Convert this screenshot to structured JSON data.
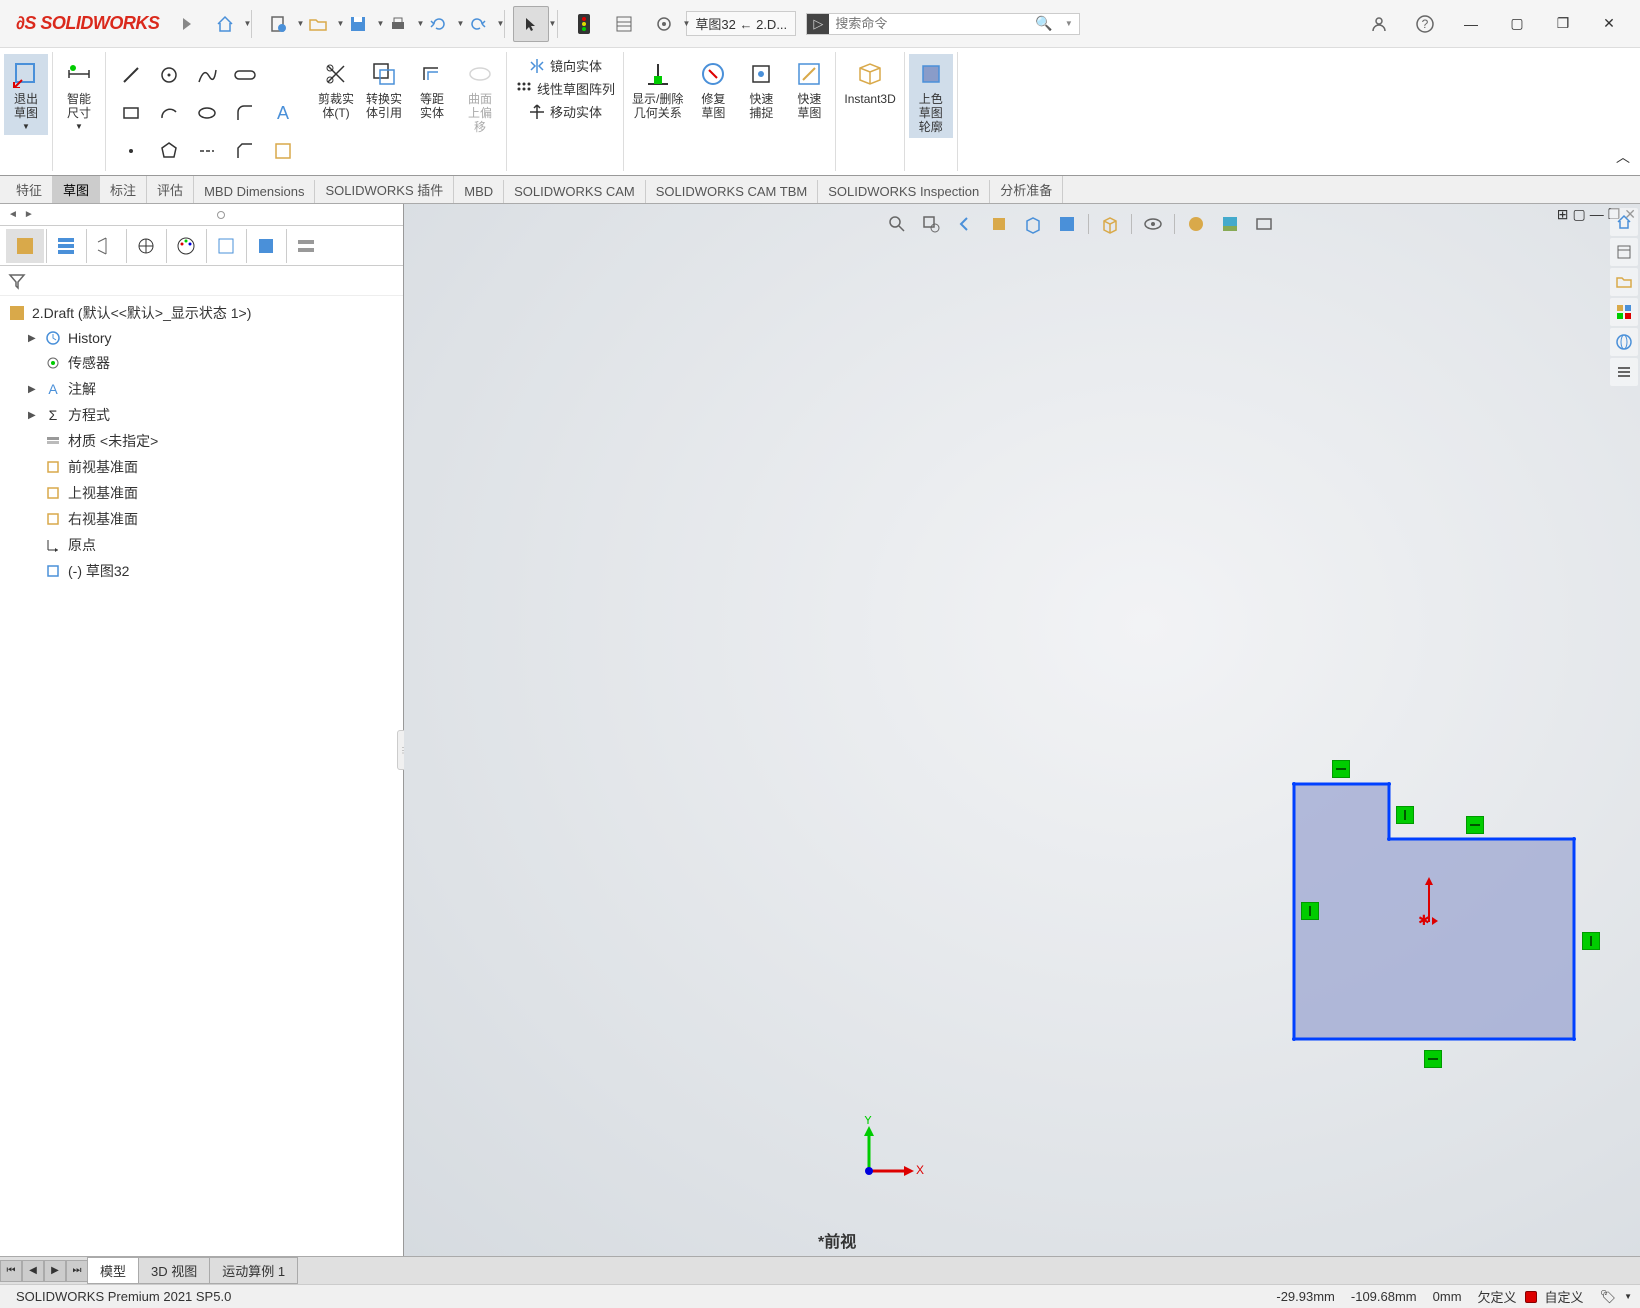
{
  "app": {
    "logo_text": "SOLIDWORKS",
    "breadcrumb": "草图32 ← 2.D...",
    "search_placeholder": "搜索命令"
  },
  "ribbon": {
    "exit_sketch": "退出\n草图",
    "smart_dim": "智能\n尺寸",
    "trim": "剪裁实\n体(T)",
    "convert": "转换实\n体引用",
    "offset": "等距\n实体",
    "surface_offset": "曲面\n上偏\n移",
    "mirror": "镜向实体",
    "pattern": "线性草图阵列",
    "move": "移动实体",
    "relations": "显示/删除\n几何关系",
    "repair": "修复\n草图",
    "quick_snap": "快速\n捕捉",
    "quick_sketch": "快速\n草图",
    "instant3d": "Instant3D",
    "shaded": "上色\n草图\n轮廓"
  },
  "tabs": {
    "items": [
      "特征",
      "草图",
      "标注",
      "评估",
      "MBD Dimensions",
      "SOLIDWORKS 插件",
      "MBD",
      "SOLIDWORKS CAM",
      "SOLIDWORKS CAM TBM",
      "SOLIDWORKS Inspection",
      "分析准备"
    ],
    "active_index": 1
  },
  "tree": {
    "root": "2.Draft  (默认<<默认>_显示状态 1>)",
    "items": [
      {
        "label": "History",
        "icon": "history"
      },
      {
        "label": "传感器",
        "icon": "sensor"
      },
      {
        "label": "注解",
        "icon": "annotation"
      },
      {
        "label": "方程式",
        "icon": "equation"
      },
      {
        "label": "材质 <未指定>",
        "icon": "material"
      },
      {
        "label": "前视基准面",
        "icon": "plane"
      },
      {
        "label": "上视基准面",
        "icon": "plane"
      },
      {
        "label": "右视基准面",
        "icon": "plane"
      },
      {
        "label": "原点",
        "icon": "origin"
      },
      {
        "label": "(-) 草图32",
        "icon": "sketch"
      }
    ]
  },
  "viewport": {
    "view_name": "*前视",
    "triad_x": "X",
    "triad_y": "Y"
  },
  "bottom_tabs": {
    "items": [
      "模型",
      "3D 视图",
      "运动算例 1"
    ],
    "active_index": 0
  },
  "status": {
    "product": "SOLIDWORKS Premium 2021 SP5.0",
    "coord_x": "-29.93mm",
    "coord_y": "-109.68mm",
    "coord_z": "0mm",
    "state": "欠定义",
    "custom": "自定义"
  }
}
